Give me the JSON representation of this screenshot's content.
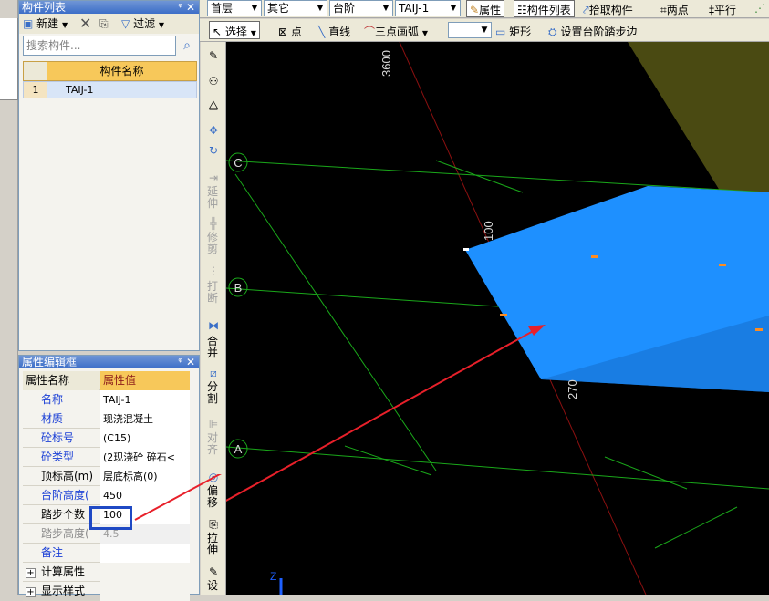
{
  "component_list": {
    "title": "构件列表",
    "pin": "ᵠ",
    "close": "✕",
    "new_label": "新建",
    "filter_label": "过滤",
    "search_placeholder": "搜索构件...",
    "header_name": "构件名称",
    "rows": [
      {
        "index": "1",
        "name": "TAIJ-1"
      }
    ]
  },
  "property_panel": {
    "title": "属性编辑框",
    "pin": "ᵠ",
    "close": "✕",
    "col_name": "属性名称",
    "col_value": "属性值",
    "rows": [
      {
        "name": "名称",
        "value": "TAIJ-1",
        "style": "blue"
      },
      {
        "name": "材质",
        "value": "现浇混凝土",
        "style": "blue"
      },
      {
        "name": "砼标号",
        "value": "(C15)",
        "style": "blue"
      },
      {
        "name": "砼类型",
        "value": "(2现浇砼 碎石<",
        "style": "blue"
      },
      {
        "name": "顶标高(m)",
        "value": "层底标高(0)",
        "style": "black"
      },
      {
        "name": "台阶高度(",
        "value": "450",
        "style": "blue"
      },
      {
        "name": "踏步个数",
        "value": "100",
        "style": "black"
      },
      {
        "name": "踏步高度(",
        "value": "4.5",
        "style": "gray"
      },
      {
        "name": "备注",
        "value": "",
        "style": "blue"
      },
      {
        "name": "计算属性",
        "value": "",
        "style": "group"
      },
      {
        "name": "显示样式",
        "value": "",
        "style": "group"
      }
    ]
  },
  "toolbar1": {
    "floor": "首层",
    "category": "其它",
    "type": "台阶",
    "component": "TAIJ-1",
    "properties_btn": "属性",
    "component_list_btn": "构件列表",
    "pick_btn": "拾取构件",
    "two_points_btn": "两点",
    "parallel_btn": "平行"
  },
  "toolbar2": {
    "select_btn": "选择",
    "point_btn": "点",
    "line_btn": "直线",
    "arc_btn": "三点画弧",
    "rect_btn": "矩形",
    "step_edge_btn": "设置台阶踏步边"
  },
  "vertical_tools": {
    "extend": "延伸",
    "trim": "修剪",
    "break": "打断",
    "merge": "合并",
    "split": "分割",
    "align": "对齐",
    "offset": "偏移",
    "stretch": "拉伸",
    "set": "设"
  },
  "canvas": {
    "axis_c": "C",
    "axis_b": "B",
    "axis_a": "A",
    "dim_3600": "3600",
    "dim_100": "100",
    "dim_270": "270",
    "z_label": "Z"
  },
  "colors": {
    "accent_blue": "#1a3fd6",
    "highlight_box": "#1f49c4",
    "arrow_red": "#e8202a",
    "slab_blue": "#1e90ff",
    "grid_green": "#1aa81a"
  }
}
